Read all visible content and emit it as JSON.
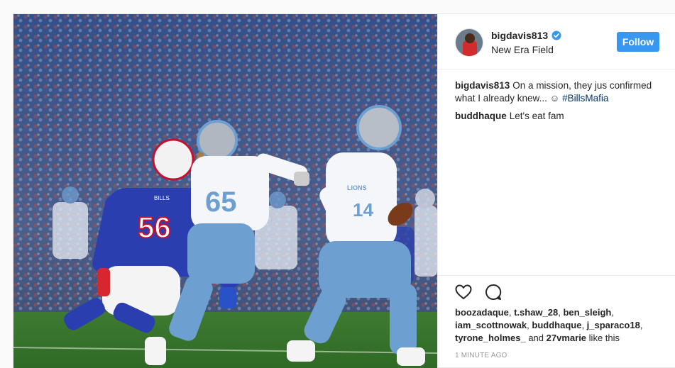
{
  "post": {
    "photo_alt": "",
    "header": {
      "username": "bigdavis813",
      "verified": true,
      "location": "New Era Field",
      "follow_label": "Follow"
    },
    "caption": {
      "user": "bigdavis813",
      "text": "On a mission, they jus confirmed what I already knew... ☺",
      "hashtag": "#BillsMafia"
    },
    "comments": [
      {
        "user": "buddhaque",
        "text": "Let's eat fam"
      }
    ],
    "likes": {
      "names": [
        "boozadaque",
        "t.shaw_28",
        "ben_sleigh",
        "iam_scottnowak",
        "buddhaque",
        "j_sparaco18",
        "tyrone_holmes_"
      ],
      "and_text": "and",
      "others": "27vmarie",
      "suffix": "like this"
    },
    "timestamp": "1 MINUTE AGO",
    "icons": {
      "like": "heart-icon",
      "comment": "comment-icon",
      "verified": "verified-badge-icon"
    },
    "jersey_numbers": [
      "56",
      "65",
      "14"
    ],
    "team_text": [
      "BILLS",
      "LIONS"
    ],
    "colors": {
      "follow_bg": "#3897f0",
      "bills_blue": "#2a3eb0",
      "lions_blue": "#6d9fd1"
    }
  }
}
